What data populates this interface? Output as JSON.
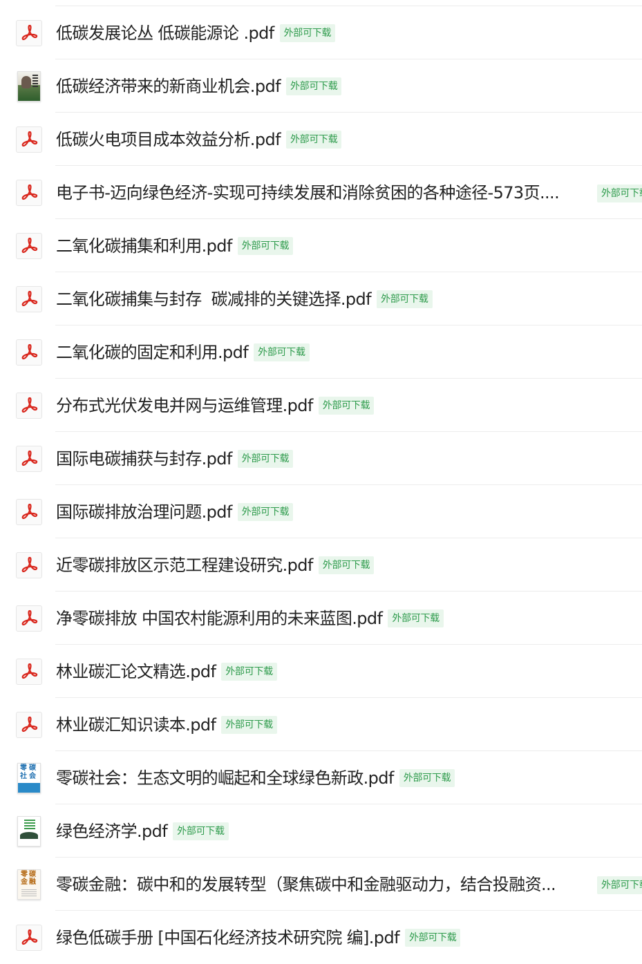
{
  "badge_label": "外部可下载",
  "files": [
    {
      "name": "低碳发展论丛 低碳能源论 .pdf",
      "icon": "pdf-icon"
    },
    {
      "name": "低碳经济带来的新商业机会.pdf",
      "icon": "book-cover-thumbnail"
    },
    {
      "name": "低碳火电项目成本效益分析.pdf",
      "icon": "pdf-icon"
    },
    {
      "name": "电子书-迈向绿色经济-实现可持续发展和消除贫困的各种途径-573页....",
      "icon": "pdf-icon"
    },
    {
      "name": "二氧化碳捕集和利用.pdf",
      "icon": "pdf-icon"
    },
    {
      "name": "二氧化碳捕集与封存  碳减排的关键选择.pdf",
      "icon": "pdf-icon"
    },
    {
      "name": "二氧化碳的固定和利用.pdf",
      "icon": "pdf-icon"
    },
    {
      "name": "分布式光伏发电并网与运维管理.pdf",
      "icon": "pdf-icon"
    },
    {
      "name": "国际电碳捕获与封存.pdf",
      "icon": "pdf-icon"
    },
    {
      "name": "国际碳排放治理问题.pdf",
      "icon": "pdf-icon"
    },
    {
      "name": "近零碳排放区示范工程建设研究.pdf",
      "icon": "pdf-icon"
    },
    {
      "name": "净零碳排放 中国农村能源利用的未来蓝图.pdf",
      "icon": "pdf-icon"
    },
    {
      "name": "林业碳汇论文精选.pdf",
      "icon": "pdf-icon"
    },
    {
      "name": "林业碳汇知识读本.pdf",
      "icon": "pdf-icon"
    },
    {
      "name": "零碳社会：生态文明的崛起和全球绿色新政.pdf",
      "icon": "book-cover-thumbnail"
    },
    {
      "name": "绿色经济学.pdf",
      "icon": "book-cover-thumbnail"
    },
    {
      "name": "零碳金融：碳中和的发展转型（聚焦碳中和金融驱动力，结合投融资...",
      "icon": "book-cover-thumbnail"
    },
    {
      "name": "绿色低碳手册 [中国石化经济技术研究院 编].pdf",
      "icon": "pdf-icon"
    }
  ],
  "cover_text": {
    "zero_carbon_society": [
      "零碳",
      "社会"
    ],
    "zero_carbon_finance": [
      "零碳",
      "金融"
    ]
  },
  "colors": {
    "pdf_red": "#d9261c",
    "badge_text": "#2e9b4c",
    "badge_bg": "#e9f6ec",
    "divider": "#ececec"
  }
}
